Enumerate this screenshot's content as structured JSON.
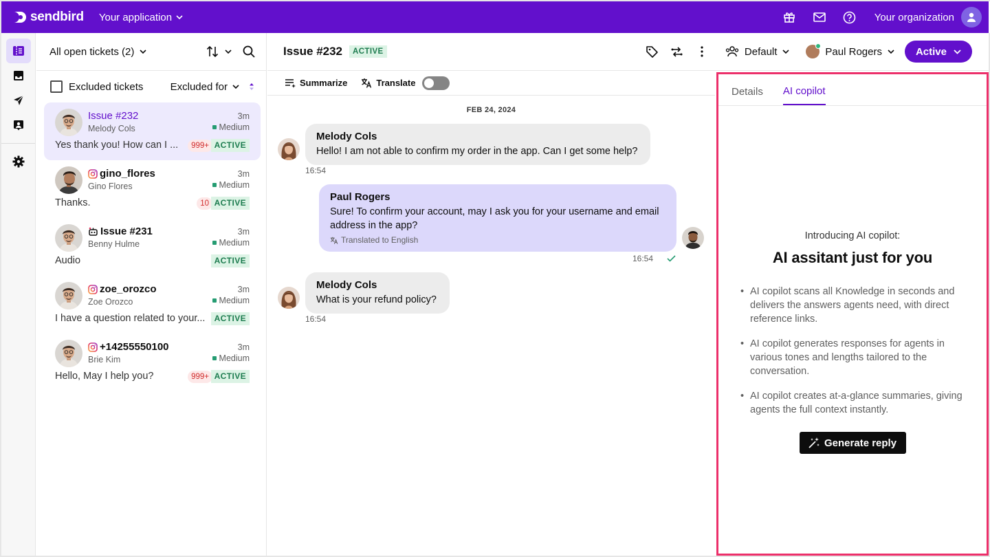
{
  "brand": {
    "logo_text": "sendbird",
    "accent": "#6210cc",
    "highlight_border": "#ec2f6a"
  },
  "topbar": {
    "app_selector": "Your application",
    "icons": [
      "gift-icon",
      "mail-icon",
      "help-icon"
    ],
    "org_name": "Your organization"
  },
  "rail": {
    "items": [
      "tickets-icon",
      "inbox-icon",
      "send-icon",
      "contact-icon",
      "settings-icon"
    ]
  },
  "tickets": {
    "filter_label": "All open tickets (2)",
    "excluded_label": "Excluded tickets",
    "excluded_for_label": "Excluded for",
    "items": [
      {
        "title": "Issue #232",
        "subtitle": "Melody Cols",
        "time": "3m",
        "priority": "Medium",
        "message": "Yes thank you! How can I ...",
        "count": "999+",
        "status": "ACTIVE",
        "channel": "none"
      },
      {
        "title": "gino_flores",
        "subtitle": "Gino Flores",
        "time": "3m",
        "priority": "Medium",
        "message": "Thanks.",
        "count": "10",
        "status": "ACTIVE",
        "channel": "instagram"
      },
      {
        "title": "Issue #231",
        "subtitle": "Benny Hulme",
        "time": "3m",
        "priority": "Medium",
        "message": "Audio",
        "count": "",
        "status": "ACTIVE",
        "channel": "bot"
      },
      {
        "title": "zoe_orozco",
        "subtitle": "Zoe Orozco",
        "time": "3m",
        "priority": "Medium",
        "message": "I have a question related to your...",
        "count": "",
        "status": "ACTIVE",
        "channel": "instagram"
      },
      {
        "title": "+14255550100",
        "subtitle": "Brie Kim",
        "time": "3m",
        "priority": "Medium",
        "message": "Hello, May I help you?",
        "count": "999+",
        "status": "ACTIVE",
        "channel": "instagram"
      }
    ]
  },
  "conversation": {
    "title": "Issue #232",
    "status_badge": "ACTIVE",
    "group_select": "Default",
    "agent_select": "Paul Rogers",
    "status_button": "Active",
    "tools": {
      "summarize": "Summarize",
      "translate": "Translate"
    },
    "date": "FEB 24, 2024",
    "messages": [
      {
        "sender": "Melody Cols",
        "text": "Hello! I am not able to confirm my order in the app. Can I get some help?",
        "time": "16:54"
      },
      {
        "sender": "Paul Rogers",
        "text": "Sure! To confirm your account, may I ask you for your username and email address in the app?",
        "translated": "Translated to English",
        "time": "16:54"
      },
      {
        "sender": "Melody Cols",
        "text": "What is your refund policy?",
        "time": "16:54"
      }
    ]
  },
  "panel": {
    "tabs": [
      "Details",
      "AI copilot"
    ],
    "active_tab": "AI copilot",
    "kicker": "Introducing AI copilot:",
    "title": "AI assitant just for you",
    "bullets": [
      "AI copilot scans all Knowledge in seconds and delivers the answers agents need, with direct reference links.",
      "AI copilot generates responses for agents in various tones and lengths tailored to the conversation.",
      "AI copilot creates at-a-glance summaries, giving agents the full context instantly."
    ],
    "button": "Generate reply"
  }
}
